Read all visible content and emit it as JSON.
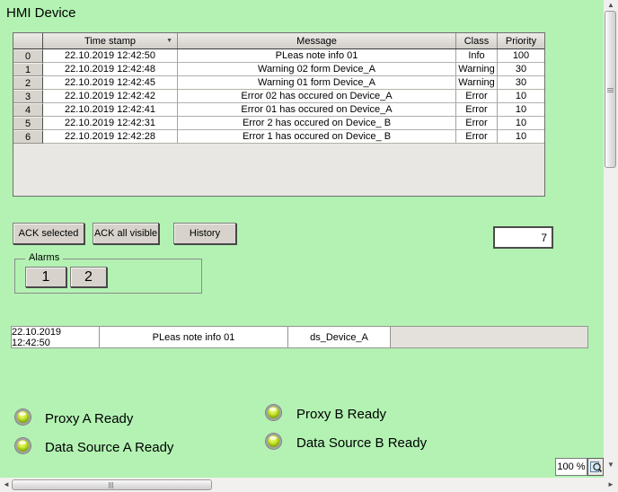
{
  "window": {
    "title": "HMI Device"
  },
  "colors": {
    "background": "#b3f2b3",
    "table_header": "#dbd8d2",
    "table_filler": "#e9e7e3",
    "button_face": "#d7d3cc",
    "led_green": "#a7d510",
    "alarm_line_empty": "#e4e1dc"
  },
  "alarm_table": {
    "columns": [
      "",
      "Time stamp",
      "Message",
      "Class",
      "Priority"
    ],
    "rows": [
      {
        "num": "0",
        "time": "22.10.2019 12:42:50",
        "message": "PLeas note info 01",
        "class": "Info",
        "priority": "100"
      },
      {
        "num": "1",
        "time": "22.10.2019 12:42:48",
        "message": "Warning 02 form Device_A",
        "class": "Warning",
        "priority": "30"
      },
      {
        "num": "2",
        "time": "22.10.2019 12:42:45",
        "message": "Warning 01 form Device_A",
        "class": "Warning",
        "priority": "30"
      },
      {
        "num": "3",
        "time": "22.10.2019 12:42:42",
        "message": "Error 02 has occured on Device_A",
        "class": "Error",
        "priority": "10"
      },
      {
        "num": "4",
        "time": "22.10.2019 12:42:41",
        "message": "Error 01 has occured on Device_A",
        "class": "Error",
        "priority": "10"
      },
      {
        "num": "5",
        "time": "22.10.2019 12:42:31",
        "message": "Error 2 has occured on Device_ B",
        "class": "Error",
        "priority": "10"
      },
      {
        "num": "6",
        "time": "22.10.2019 12:42:28",
        "message": "Error 1 has occured on Device_ B",
        "class": "Error",
        "priority": "10"
      }
    ]
  },
  "toolbar": {
    "ack_selected": "ACK selected",
    "ack_all_visible": "ACK all visible",
    "history": "History"
  },
  "alarm_count_field": {
    "value": "7"
  },
  "alarms_group": {
    "label": "Alarms",
    "button_1": "1",
    "button_2": "2"
  },
  "alarm_line": {
    "timestamp": "22.10.2019 12:42:50",
    "message": "PLeas note info 01",
    "source": "ds_Device_A"
  },
  "status_leds": [
    {
      "label": "Proxy A Ready"
    },
    {
      "label": "Data Source A Ready"
    },
    {
      "label": "Proxy B Ready"
    },
    {
      "label": "Data Source B Ready"
    }
  ],
  "zoom_control": {
    "value": "100 %"
  },
  "icons": {
    "sort_desc": "▼",
    "scroll_up": "▲",
    "scroll_down": "▼",
    "scroll_left": "◄",
    "scroll_right": "►",
    "zoom": "magnifier-icon"
  }
}
